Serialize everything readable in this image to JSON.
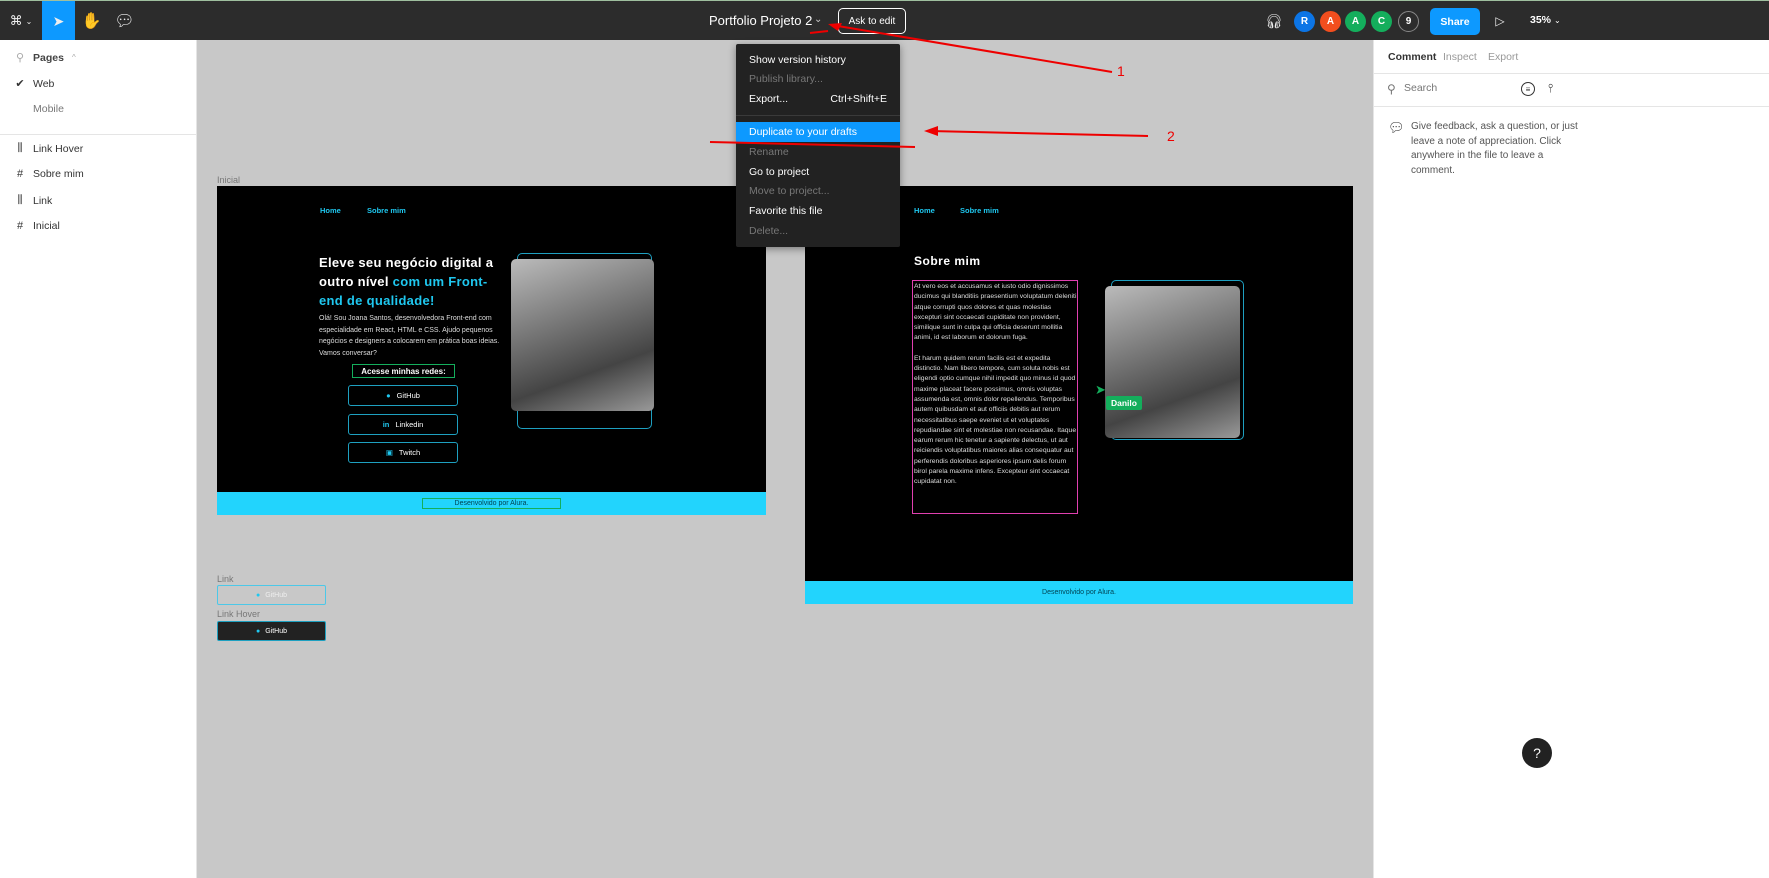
{
  "topbar": {
    "file_title": "Portfolio Projeto 2",
    "ask_to_edit": "Ask to edit",
    "share": "Share",
    "zoom": "35%",
    "avatars": [
      {
        "letter": "R",
        "color": "#0c75e6"
      },
      {
        "letter": "A",
        "color": "#f24e1e"
      },
      {
        "letter": "A",
        "color": "#14ae5c"
      },
      {
        "letter": "C",
        "color": "#14ae5c"
      }
    ],
    "more_count": "9",
    "accent": "#0d99ff"
  },
  "sidebar": {
    "pages_label": "Pages",
    "pages": [
      {
        "label": "Web",
        "selected": true
      },
      {
        "label": "Mobile",
        "selected": false
      }
    ],
    "layers": [
      {
        "label": "Link Hover",
        "icon": "component-icon"
      },
      {
        "label": "Sobre mim",
        "icon": "frame-icon"
      },
      {
        "label": "Link",
        "icon": "component-icon"
      },
      {
        "label": "Inicial",
        "icon": "frame-icon"
      }
    ]
  },
  "menu": {
    "items": [
      {
        "label": "Show version history",
        "disabled": false
      },
      {
        "label": "Publish library...",
        "disabled": true
      },
      {
        "label": "Export...",
        "shortcut": "Ctrl+Shift+E",
        "disabled": false
      },
      {
        "label": "Duplicate to your drafts",
        "disabled": false,
        "highlighted": true
      },
      {
        "label": "Rename",
        "disabled": true
      },
      {
        "label": "Go to project",
        "disabled": false
      },
      {
        "label": "Move to project...",
        "disabled": true
      },
      {
        "label": "Favorite this file",
        "disabled": false
      },
      {
        "label": "Delete...",
        "disabled": true
      }
    ]
  },
  "annotations": {
    "label1": "1",
    "label2": "2"
  },
  "canvas": {
    "frame_inicial": {
      "name": "Inicial",
      "nav": [
        "Home",
        "Sobre mim"
      ],
      "headline_white": "Eleve seu negócio digital a outro nível ",
      "headline_cyan": "com um Front-end de qualidade!",
      "intro": "Olá! Sou Joana Santos, desenvolvedora Front-end com especialidade em React, HTML e CSS. Ajudo pequenos negócios e designers a colocarem em prática boas ideias. Vamos conversar?",
      "social_heading": "Acesse minhas redes:",
      "links": [
        "GitHub",
        "Linkedin",
        "Twitch"
      ],
      "footer": "Desenvolvido por Alura."
    },
    "frame_sobre": {
      "nav": [
        "Home",
        "Sobre mim"
      ],
      "title": "Sobre mim",
      "para1": "At vero eos et accusamus et iusto odio dignissimos ducimus qui blanditiis praesentium voluptatum deleniti atque corrupti quos dolores et quas molestias excepturi sint occaecati cupiditate non provident, similique sunt in culpa qui officia deserunt mollitia animi, id est laborum et dolorum fuga.",
      "para2": "Et harum quidem rerum facilis est et expedita distinctio. Nam libero tempore, cum soluta nobis est eligendi optio cumque nihil impedit quo minus id quod maxime placeat facere possimus, omnis voluptas assumenda est, omnis dolor repellendus. Temporibus autem quibusdam et aut officiis debitis aut rerum necessitatibus saepe eveniet ut et voluptates repudiandae sint et molestiae non recusandae. Itaque earum rerum hic tenetur a sapiente delectus, ut aut reiciendis voluptatibus maiores alias consequatur aut perferendis doloribus asperiores ipsum delis forum birol parela maxime infens. Excepteur sint occaecat cupidatat non.",
      "footer": "Desenvolvido por Alura.",
      "cursor_user": "Danilo"
    },
    "components": {
      "link_label": "Link",
      "link_text": "GitHub",
      "hover_label": "Link Hover",
      "hover_text": "GitHub"
    }
  },
  "rightpanel": {
    "tabs": [
      "Comment",
      "Inspect",
      "Export"
    ],
    "search_placeholder": "Search",
    "empty_text": "Give feedback, ask a question, or just leave a note of appreciation. Click anywhere in the file to leave a comment."
  },
  "help": "?"
}
